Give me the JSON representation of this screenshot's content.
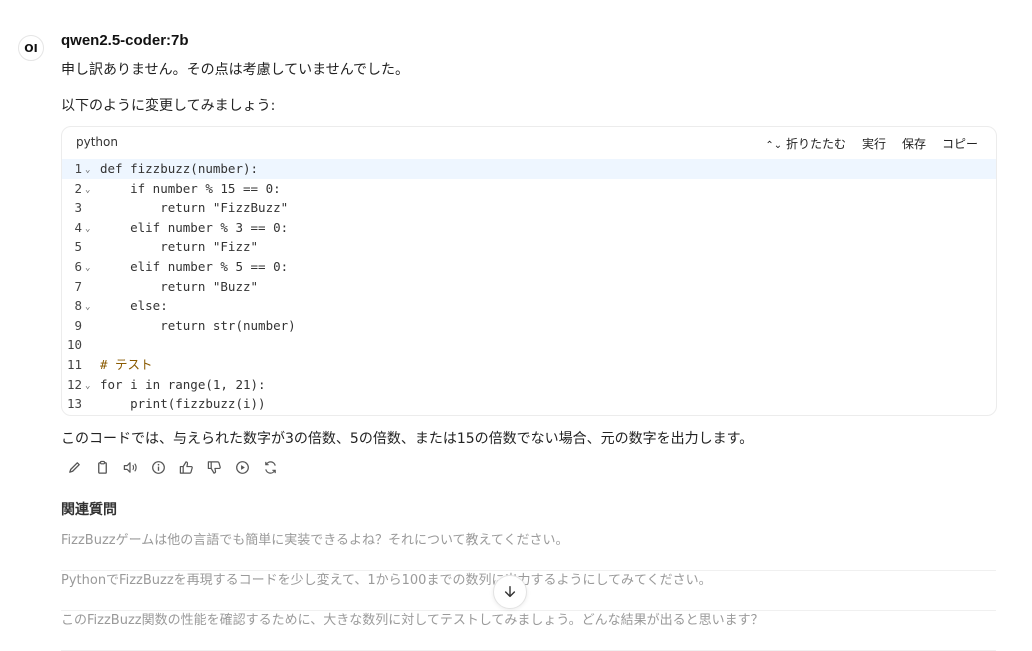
{
  "model": {
    "avatar_text": "OI",
    "name": "qwen2.5-coder:7b"
  },
  "messages": {
    "line1": "申し訳ありません。その点は考慮していませんでした。",
    "line2": "以下のように変更してみましょう:"
  },
  "code": {
    "language": "python",
    "actions": {
      "collapse": "折りたたむ",
      "run": "実行",
      "save": "保存",
      "copy": "コピー"
    },
    "lines": [
      "def fizzbuzz(number):",
      "    if number % 15 == 0:",
      "        return \"FizzBuzz\"",
      "    elif number % 3 == 0:",
      "        return \"Fizz\"",
      "    elif number % 5 == 0:",
      "        return \"Buzz\"",
      "    else:",
      "        return str(number)",
      "",
      "# テスト",
      "for i in range(1, 21):",
      "    print(fizzbuzz(i))"
    ],
    "line_numbers": [
      "1",
      "2",
      "3",
      "4",
      "5",
      "6",
      "7",
      "8",
      "9",
      "10",
      "11",
      "12",
      "13"
    ]
  },
  "summary": "このコードでは、与えられた数字が3の倍数、5の倍数、または15の倍数でない場合、元の数字を出力します。",
  "toolbar_icons": [
    "edit-icon",
    "copy-icon",
    "speaker-icon",
    "info-icon",
    "thumbs-up-icon",
    "thumbs-down-icon",
    "play-icon",
    "regenerate-icon"
  ],
  "related": {
    "title": "関連質問",
    "items": [
      "FizzBuzzゲームは他の言語でも簡単に実装できるよね？それについて教えてください。",
      "PythonでFizzBuzzを再現するコードを少し変えて、1から100までの数列に出力するようにしてみてください。",
      "このFizzBuzz関数の性能を確認するために、大きな数列に対してテストしてみましょう。どんな結果が出ると思います？"
    ]
  }
}
